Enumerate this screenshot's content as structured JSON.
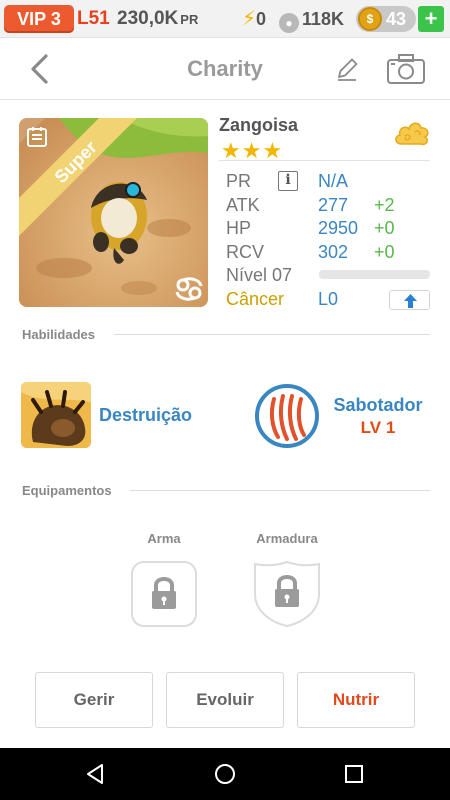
{
  "topbar": {
    "vip": "VIP 3",
    "level": "L51",
    "money": "230,0K",
    "money_unit": "PR",
    "energy": "0",
    "paw_count": "118K",
    "coins": "43",
    "add": "+"
  },
  "header": {
    "title": "Charity"
  },
  "pet": {
    "badge": "Super",
    "name": "Zangoisa",
    "stars": "★★★",
    "stats": {
      "pr_label": "PR",
      "pr_info": "i",
      "pr_value": "N/A",
      "atk_label": "ATK",
      "atk_value": "277",
      "atk_bonus": "+2",
      "hp_label": "HP",
      "hp_value": "2950",
      "hp_bonus": "+0",
      "rcv_label": "RCV",
      "rcv_value": "302",
      "rcv_bonus": "+0",
      "level_label": "Nível 07",
      "level_progress": 0,
      "sign_label": "Câncer",
      "sign_level": "L0"
    }
  },
  "skills": {
    "section": "Habilidades",
    "active_name": "Destruição",
    "passive_name": "Sabotador",
    "passive_level": "LV 1"
  },
  "equipment": {
    "section": "Equipamentos",
    "weapon": "Arma",
    "armor": "Armadura"
  },
  "actions": {
    "manage": "Gerir",
    "evolve": "Evoluir",
    "feed": "Nutrir"
  },
  "colors": {
    "accent_blue": "#3a86c1",
    "bonus_green": "#58b84a",
    "vip_orange": "#ec5b2f",
    "feed_red": "#e2491c"
  }
}
